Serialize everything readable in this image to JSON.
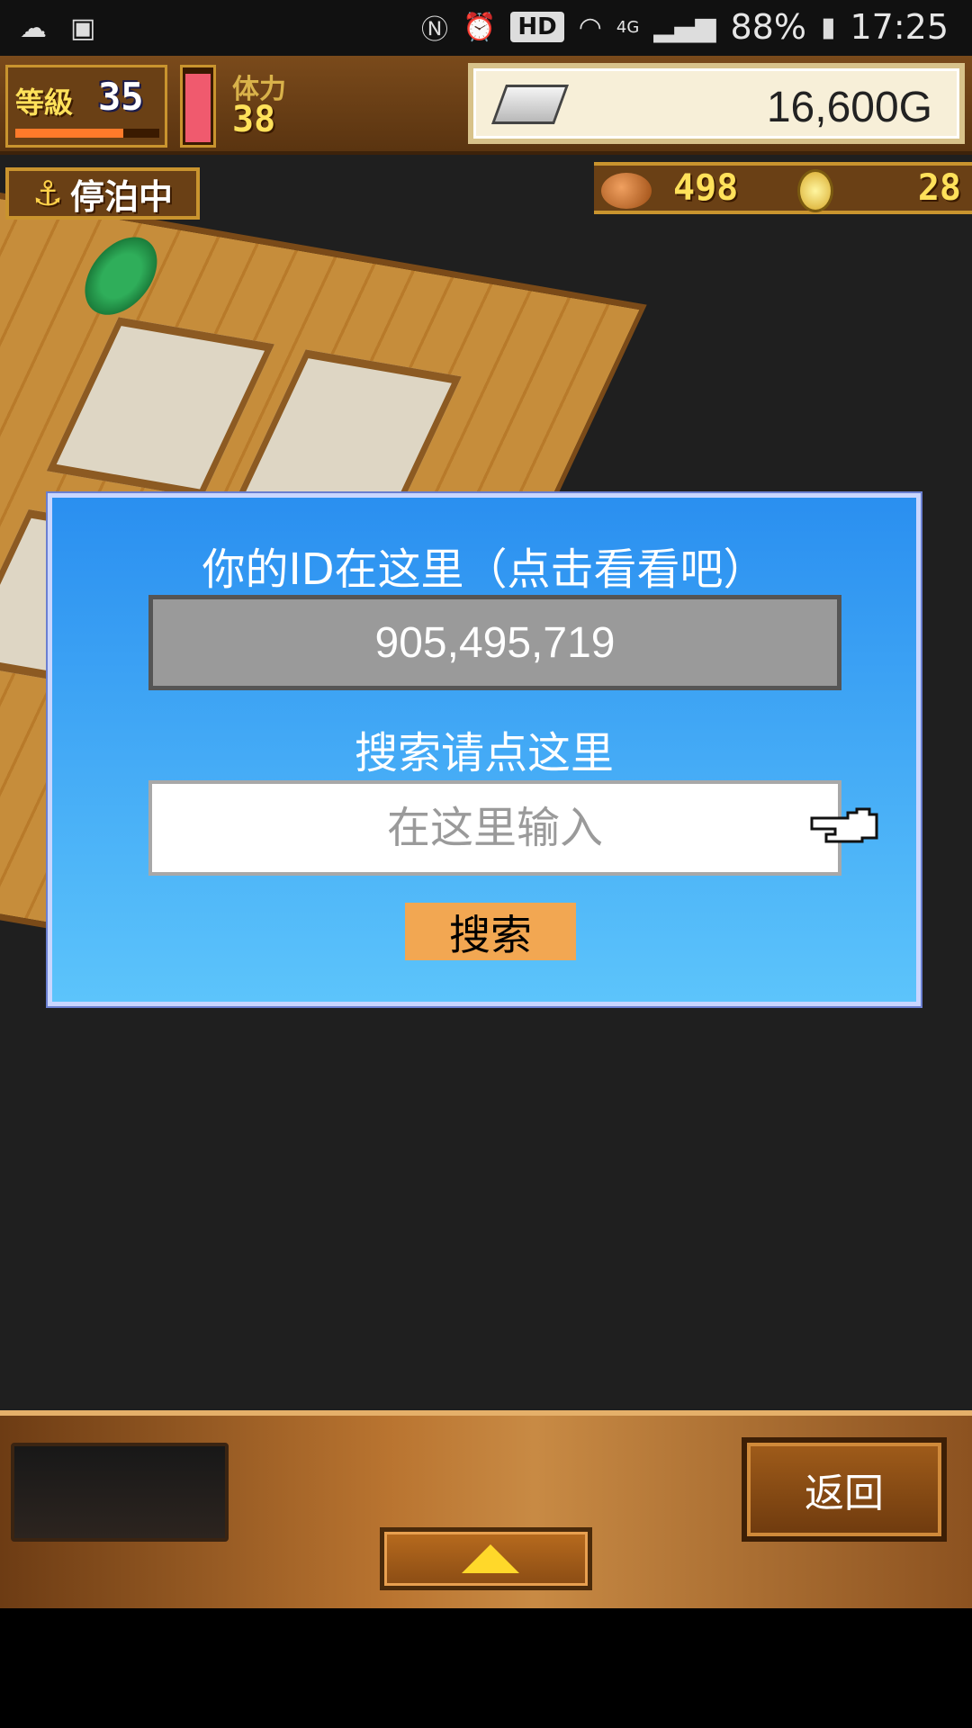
{
  "status_bar": {
    "battery": "88%",
    "time": "17:25",
    "network": "4G",
    "hd": "HD",
    "icons": [
      "cloud-icon",
      "image-icon",
      "nfc-icon",
      "alarm-icon",
      "wifi-icon",
      "signal-icon",
      "battery-icon"
    ]
  },
  "hud": {
    "level_label": "等級",
    "level_value": "35",
    "level_progress": 0.75,
    "stamina_label": "体力",
    "stamina_value": "38",
    "stamina_level": 0.95,
    "gold": "16,600G",
    "docked_label": "停泊中",
    "food": "498",
    "coins": "28"
  },
  "dialog": {
    "id_caption": "你的ID在这里（点击看看吧）",
    "id_value": "905,495,719",
    "search_caption": "搜索请点这里",
    "search_placeholder": "在这里输入",
    "search_button": "搜索"
  },
  "bottom": {
    "back_button": "返回"
  }
}
